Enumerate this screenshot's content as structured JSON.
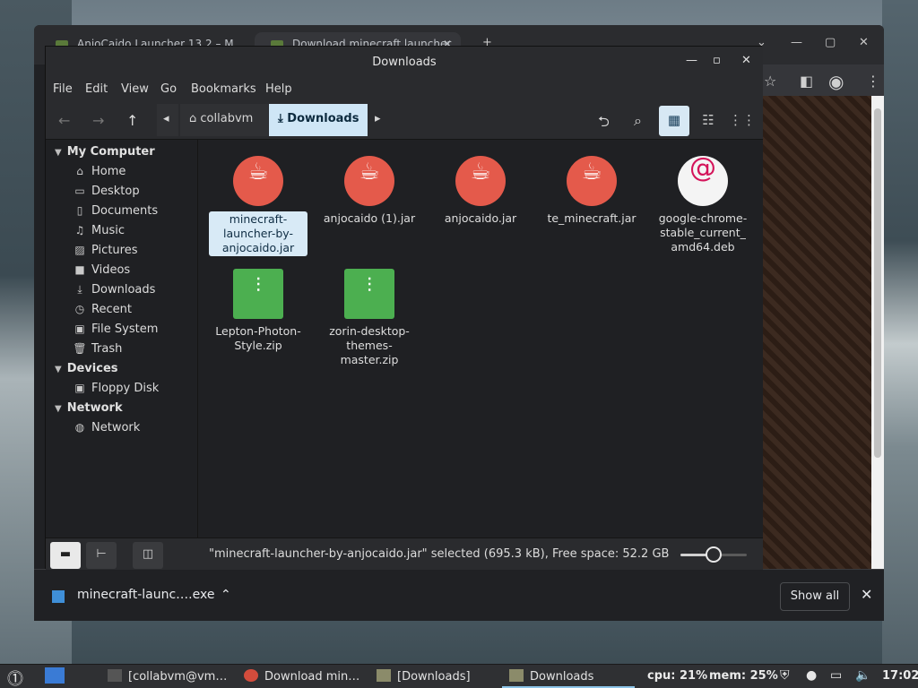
{
  "browser": {
    "tabs": [
      {
        "label": "AnjoCaido Launcher 13.2 – M…"
      },
      {
        "label": "Download minecraft launcher…"
      }
    ],
    "download_item": "minecraft-launc….exe",
    "show_all": "Show all"
  },
  "window": {
    "title": "Downloads",
    "menu": [
      "File",
      "Edit",
      "View",
      "Go",
      "Bookmarks",
      "Help"
    ],
    "breadcrumbs": [
      "collabvm",
      "Downloads"
    ]
  },
  "sidebar": {
    "sections": [
      {
        "title": "My Computer",
        "items": [
          "Home",
          "Desktop",
          "Documents",
          "Music",
          "Pictures",
          "Videos",
          "Downloads",
          "Recent",
          "File System",
          "Trash"
        ]
      },
      {
        "title": "Devices",
        "items": [
          "Floppy Disk"
        ]
      },
      {
        "title": "Network",
        "items": [
          "Network"
        ]
      }
    ]
  },
  "files": [
    {
      "name": "minecraft-launcher-by-anjocaido.jar",
      "line1": "minecraft-",
      "line2": "launcher-by-",
      "line3": "anjocaido.jar",
      "type": "jar",
      "selected": true
    },
    {
      "name": "anjocaido (1).jar",
      "line1": "anjocaido (1).jar",
      "line2": "",
      "line3": "",
      "type": "jar"
    },
    {
      "name": "anjocaido.jar",
      "line1": "anjocaido.jar",
      "line2": "",
      "line3": "",
      "type": "jar"
    },
    {
      "name": "te_minecraft.jar",
      "line1": "te_minecraft.jar",
      "line2": "",
      "line3": "",
      "type": "jar"
    },
    {
      "name": "google-chrome-stable_current_amd64.deb",
      "line1": "google-chrome-",
      "line2": "stable_current_",
      "line3": "amd64.deb",
      "type": "deb"
    },
    {
      "name": "Lepton-Photon-Style.zip",
      "line1": "Lepton-Photon-",
      "line2": "Style.zip",
      "line3": "",
      "type": "zip"
    },
    {
      "name": "zorin-desktop-themes-master.zip",
      "line1": "zorin-desktop-",
      "line2": "themes-master.zip",
      "line3": "",
      "type": "zip"
    }
  ],
  "status": {
    "text": "\"minecraft-launcher-by-anjocaido.jar\" selected (695.3 kB), Free space: 52.2 GB",
    "zoom_fraction": 0.5
  },
  "taskbar": {
    "tasks": [
      "[collabvm@vm…",
      "Download min…",
      "[Downloads]",
      "Downloads"
    ],
    "cpu": "cpu: 21%",
    "mem": "mem: 25%",
    "clock": "17:02"
  },
  "colors": {
    "accent": "#cfe6f6",
    "jar": "#e45a4b",
    "zip": "#4caf50"
  }
}
